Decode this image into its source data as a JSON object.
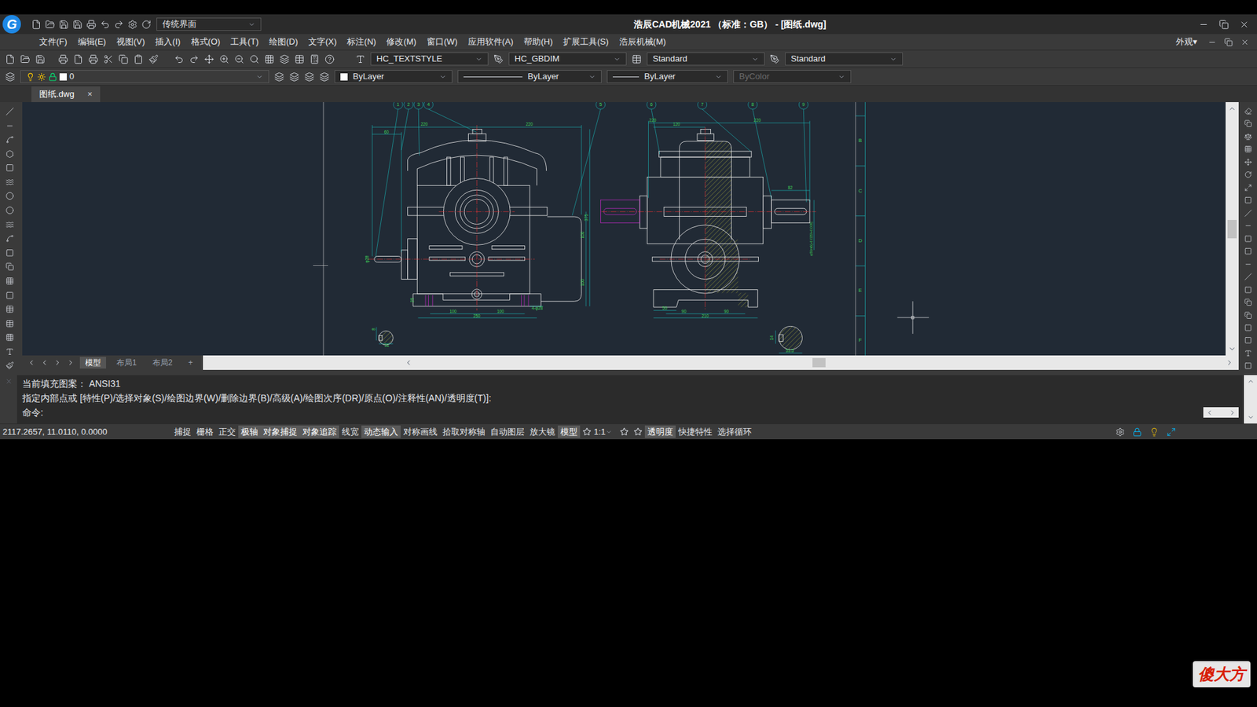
{
  "window": {
    "logo": "G",
    "quick_access_combo": "传统界面",
    "title": "浩辰CAD机械2021 （标准：GB） - [图纸.dwg]"
  },
  "menu": [
    "文件(F)",
    "编辑(E)",
    "视图(V)",
    "插入(I)",
    "格式(O)",
    "工具(T)",
    "绘图(D)",
    "文字(X)",
    "标注(N)",
    "修改(M)",
    "窗口(W)",
    "应用软件(A)",
    "帮助(H)",
    "扩展工具(S)",
    "浩辰机械(M)"
  ],
  "menu_right": "外观▾",
  "styles": {
    "text_style": "HC_TEXTSTYLE",
    "dim_style": "HC_GBDIM",
    "table_style": "Standard",
    "multileader_style": "Standard"
  },
  "properties": {
    "layer": "0",
    "color": "ByLayer",
    "linetype": "ByLayer",
    "lineweight": "ByLayer",
    "plot_style": "ByColor",
    "plot_style_disabled": true
  },
  "doc_tabs": [
    {
      "label": "图纸.dwg",
      "selected": true,
      "close": "×"
    }
  ],
  "drawing": {
    "balloons": [
      "1",
      "2",
      "3",
      "4",
      "5",
      "6",
      "7",
      "8",
      "9"
    ],
    "dimensions": [
      "220",
      "220",
      "60",
      "375",
      "100",
      "100",
      "φ28",
      "25",
      "100",
      "100",
      "250",
      "4-φ28",
      "8",
      "31",
      "220",
      "120",
      "220",
      "82",
      "φ50m6(+0.025/+0.009)",
      "50",
      "90",
      "90",
      "210",
      "14",
      "53.5"
    ],
    "zone_labels": [
      "B",
      "C",
      "D",
      "E",
      "F"
    ]
  },
  "layout_tabs": [
    {
      "label": "模型",
      "selected": true
    },
    {
      "label": "布局1",
      "selected": false
    },
    {
      "label": "布局2",
      "selected": false
    },
    {
      "label": "+",
      "selected": false
    }
  ],
  "command_lines": [
    "当前填充图案：  ANSI31",
    "指定内部点或 [特性(P)/选择对象(S)/绘图边界(W)/删除边界(B)/高级(A)/绘图次序(DR)/原点(O)/注释性(AN)/透明度(T)]:"
  ],
  "command_prompt": "命令:",
  "status_bar": {
    "coordinates": "2117.2657, 11.0110, 0.0000",
    "toggles": [
      {
        "label": "捕捉",
        "on": false
      },
      {
        "label": "栅格",
        "on": false
      },
      {
        "label": "正交",
        "on": false
      },
      {
        "label": "极轴",
        "on": true
      },
      {
        "label": "对象捕捉",
        "on": true
      },
      {
        "label": "对象追踪",
        "on": true
      },
      {
        "label": "线宽",
        "on": false
      },
      {
        "label": "动态输入",
        "on": true
      },
      {
        "label": "对称画线",
        "on": false
      },
      {
        "label": "拾取对称轴",
        "on": false
      },
      {
        "label": "自动图层",
        "on": false
      },
      {
        "label": "放大镜",
        "on": false
      },
      {
        "label": "模型",
        "on": true
      }
    ],
    "scale": "1:1",
    "toggles2": [
      {
        "label": "透明度",
        "on": true
      },
      {
        "label": "快捷特性",
        "on": false
      },
      {
        "label": "选择循环",
        "on": false
      }
    ]
  },
  "watermark": "傻大方"
}
